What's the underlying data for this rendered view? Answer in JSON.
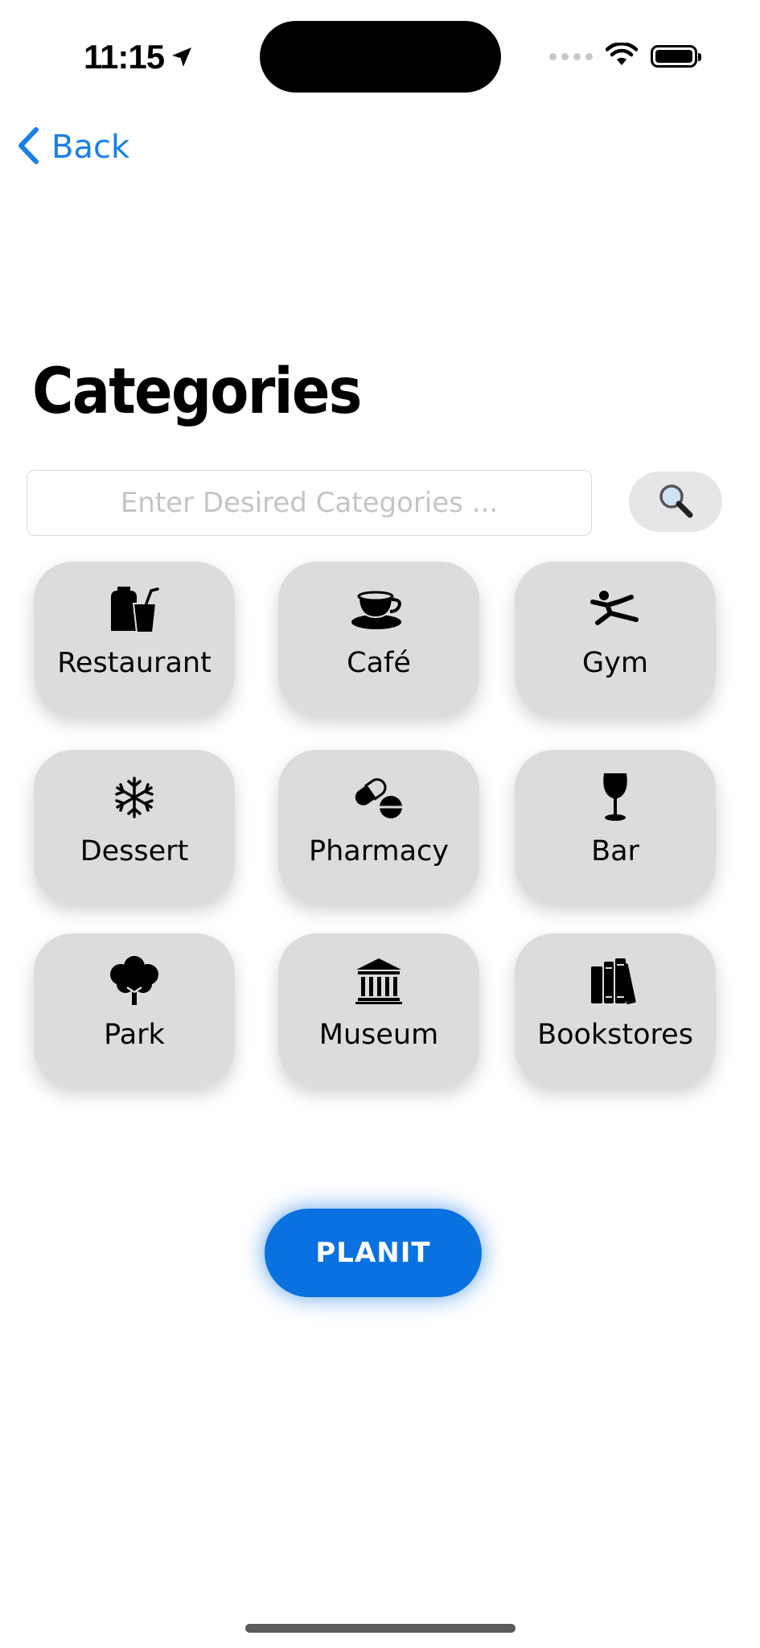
{
  "status_bar": {
    "time": "11:15"
  },
  "nav": {
    "back_label": "Back"
  },
  "page": {
    "title": "Categories"
  },
  "search": {
    "placeholder": "Enter Desired Categories ...",
    "value": ""
  },
  "categories": [
    {
      "label": "Restaurant",
      "icon": "takeout-bag-cup-icon"
    },
    {
      "label": "Café",
      "icon": "coffee-cup-icon"
    },
    {
      "label": "Gym",
      "icon": "figure-stretch-icon"
    },
    {
      "label": "Dessert",
      "icon": "snowflake-icon"
    },
    {
      "label": "Pharmacy",
      "icon": "pills-icon"
    },
    {
      "label": "Bar",
      "icon": "wine-glass-icon"
    },
    {
      "label": "Park",
      "icon": "tree-icon"
    },
    {
      "label": "Museum",
      "icon": "building-columns-icon"
    },
    {
      "label": "Bookstores",
      "icon": "books-icon"
    }
  ],
  "primary_action": {
    "label": "PLANIT"
  },
  "colors": {
    "accent": "#0a72e0",
    "back_link": "#1a7fe8",
    "tile_bg": "#dcdcde"
  }
}
